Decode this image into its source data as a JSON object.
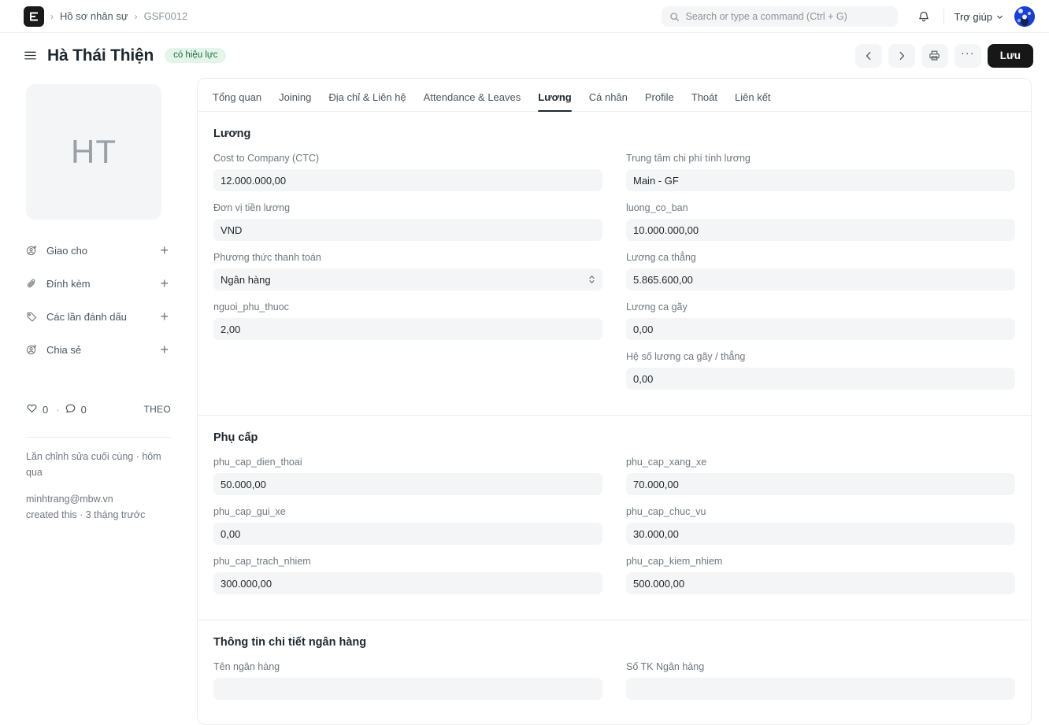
{
  "navbar": {
    "logo_text": "E",
    "breadcrumb": [
      {
        "label": "Hồ sơ nhân sự",
        "current": false
      },
      {
        "label": "GSF0012",
        "current": true
      }
    ],
    "search": {
      "placeholder": "Search or type a command (Ctrl + G)",
      "value": "",
      "icon": "search-icon"
    },
    "bell_icon": "bell-icon",
    "help_label": "Trợ giúp",
    "help_caret_icon": "chevron-down-icon",
    "avatar_icon": "user-avatar"
  },
  "pagehead": {
    "menu_icon": "hamburger-menu-icon",
    "title": "Hà Thái Thiện",
    "status_badge": "có hiệu lực",
    "status_badge_bg": "#e3f5e9",
    "status_badge_color": "#20693c",
    "prev_icon": "chevron-left-icon",
    "next_icon": "chevron-right-icon",
    "print_icon": "printer-icon",
    "more_label": "···",
    "save_label": "Lưu",
    "save_bg": "#171717"
  },
  "sidebar": {
    "avatar_initials": "HT",
    "items": [
      {
        "label": "Giao cho",
        "icon": "assign-user-icon",
        "add_icon": "plus-icon"
      },
      {
        "label": "Đính kèm",
        "icon": "paperclip-icon",
        "add_icon": "plus-icon"
      },
      {
        "label": "Các lần đánh dấu",
        "icon": "tag-icon",
        "add_icon": "plus-icon"
      },
      {
        "label": "Chia sẻ",
        "icon": "share-user-icon",
        "add_icon": "plus-icon"
      }
    ],
    "social": {
      "like_icon": "heart-icon",
      "like_count": "0",
      "separator": "·",
      "comment_icon": "comment-icon",
      "comment_count": "0",
      "follow_label": "THEO"
    },
    "meta": {
      "modified": "Lần chỉnh sửa cuối cùng · hôm qua",
      "creator": "minhtrang@mbw.vn",
      "created": "created this · 3 tháng trước"
    }
  },
  "tabs": [
    {
      "label": "Tổng quan",
      "active": false
    },
    {
      "label": "Joining",
      "active": false
    },
    {
      "label": "Địa chỉ & Liên hệ",
      "active": false
    },
    {
      "label": "Attendance & Leaves",
      "active": false
    },
    {
      "label": "Lương",
      "active": true
    },
    {
      "label": "Cá nhân",
      "active": false
    },
    {
      "label": "Profile",
      "active": false
    },
    {
      "label": "Thoát",
      "active": false
    },
    {
      "label": "Liên kết",
      "active": false
    }
  ],
  "sections": [
    {
      "title": "Lương",
      "left": [
        {
          "label": "Cost to Company (CTC)",
          "value": "12.000.000,00",
          "type": "text"
        },
        {
          "label": "Đơn vị tiền lương",
          "value": "VND",
          "type": "text"
        },
        {
          "label": "Phương thức thanh toán",
          "value": "Ngân hàng",
          "type": "select"
        },
        {
          "label": "nguoi_phu_thuoc",
          "value": "2,00",
          "type": "text"
        }
      ],
      "right": [
        {
          "label": "Trung tâm chi phí tính lương",
          "value": "Main - GF",
          "type": "text"
        },
        {
          "label": "luong_co_ban",
          "value": "10.000.000,00",
          "type": "text"
        },
        {
          "label": "Lương ca thẳng",
          "value": "5.865.600,00",
          "type": "text"
        },
        {
          "label": "Lương ca gãy",
          "value": "0,00",
          "type": "text"
        },
        {
          "label": "Hệ số lương ca gãy / thẳng",
          "value": "0,00",
          "type": "text"
        }
      ]
    },
    {
      "title": "Phụ cấp",
      "left": [
        {
          "label": "phu_cap_dien_thoai",
          "value": "50.000,00",
          "type": "text"
        },
        {
          "label": "phu_cap_gui_xe",
          "value": "0,00",
          "type": "text"
        },
        {
          "label": "phu_cap_trach_nhiem",
          "value": "300.000,00",
          "type": "text"
        }
      ],
      "right": [
        {
          "label": "phu_cap_xang_xe",
          "value": "70.000,00",
          "type": "text"
        },
        {
          "label": "phu_cap_chuc_vu",
          "value": "30.000,00",
          "type": "text"
        },
        {
          "label": "phu_cap_kiem_nhiem",
          "value": "500.000,00",
          "type": "text"
        }
      ]
    },
    {
      "title": "Thông tin chi tiết ngân hàng",
      "left": [
        {
          "label": "Tên ngân hàng",
          "value": "",
          "type": "text"
        }
      ],
      "right": [
        {
          "label": "Số TK Ngân hàng",
          "value": "",
          "type": "text"
        }
      ]
    }
  ]
}
